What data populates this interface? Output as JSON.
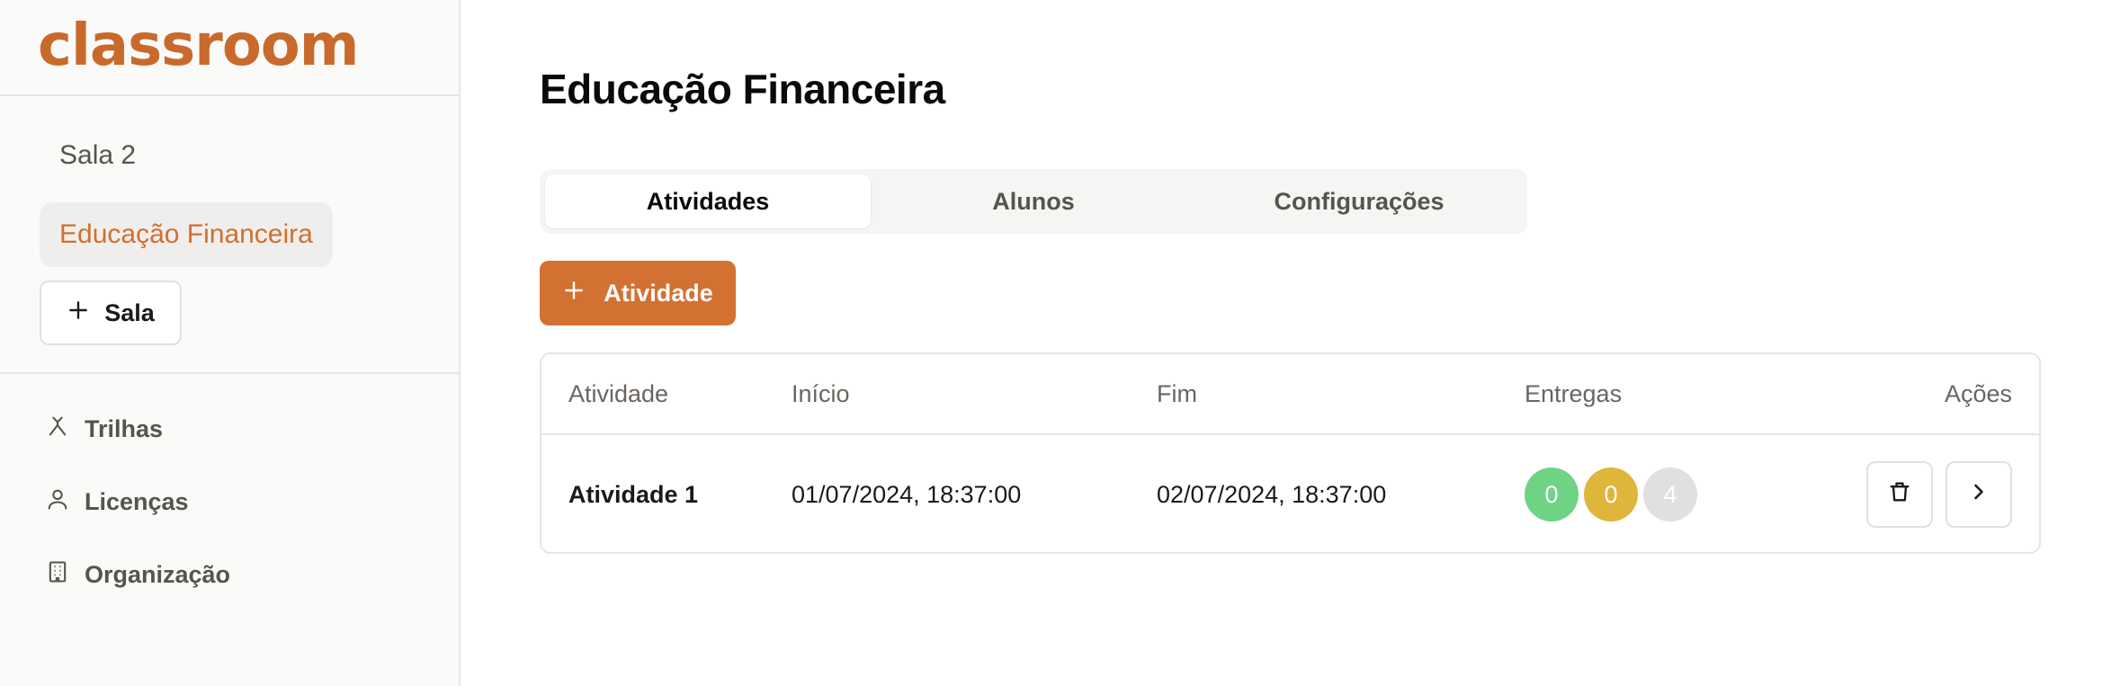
{
  "app": {
    "logo_text": "classroom",
    "brand_color": "#c96a2c"
  },
  "sidebar": {
    "rooms": [
      {
        "label": "Sala 2",
        "active": false
      },
      {
        "label": "Educação Financeira",
        "active": true
      }
    ],
    "add_room_label": "Sala",
    "nav": [
      {
        "label": "Trilhas",
        "icon": "branch-icon"
      },
      {
        "label": "Licenças",
        "icon": "user-icon"
      },
      {
        "label": "Organização",
        "icon": "building-icon"
      }
    ]
  },
  "main": {
    "title": "Educação Financeira",
    "tabs": [
      {
        "label": "Atividades",
        "active": true
      },
      {
        "label": "Alunos",
        "active": false
      },
      {
        "label": "Configurações",
        "active": false
      }
    ],
    "add_activity_label": "Atividade",
    "accent_color": "#d37133",
    "table": {
      "headers": [
        "Atividade",
        "Início",
        "Fim",
        "Entregas",
        "Ações"
      ],
      "rows": [
        {
          "name": "Atividade 1",
          "start": "01/07/2024, 18:37:00",
          "end": "02/07/2024, 18:37:00",
          "deliveries": [
            {
              "count": "0",
              "color": "#6fd386"
            },
            {
              "count": "0",
              "color": "#e0b53b"
            },
            {
              "count": "4",
              "color": "#e0e0df"
            }
          ],
          "actions": [
            "trash-icon",
            "chevron-right-icon"
          ]
        }
      ]
    }
  }
}
